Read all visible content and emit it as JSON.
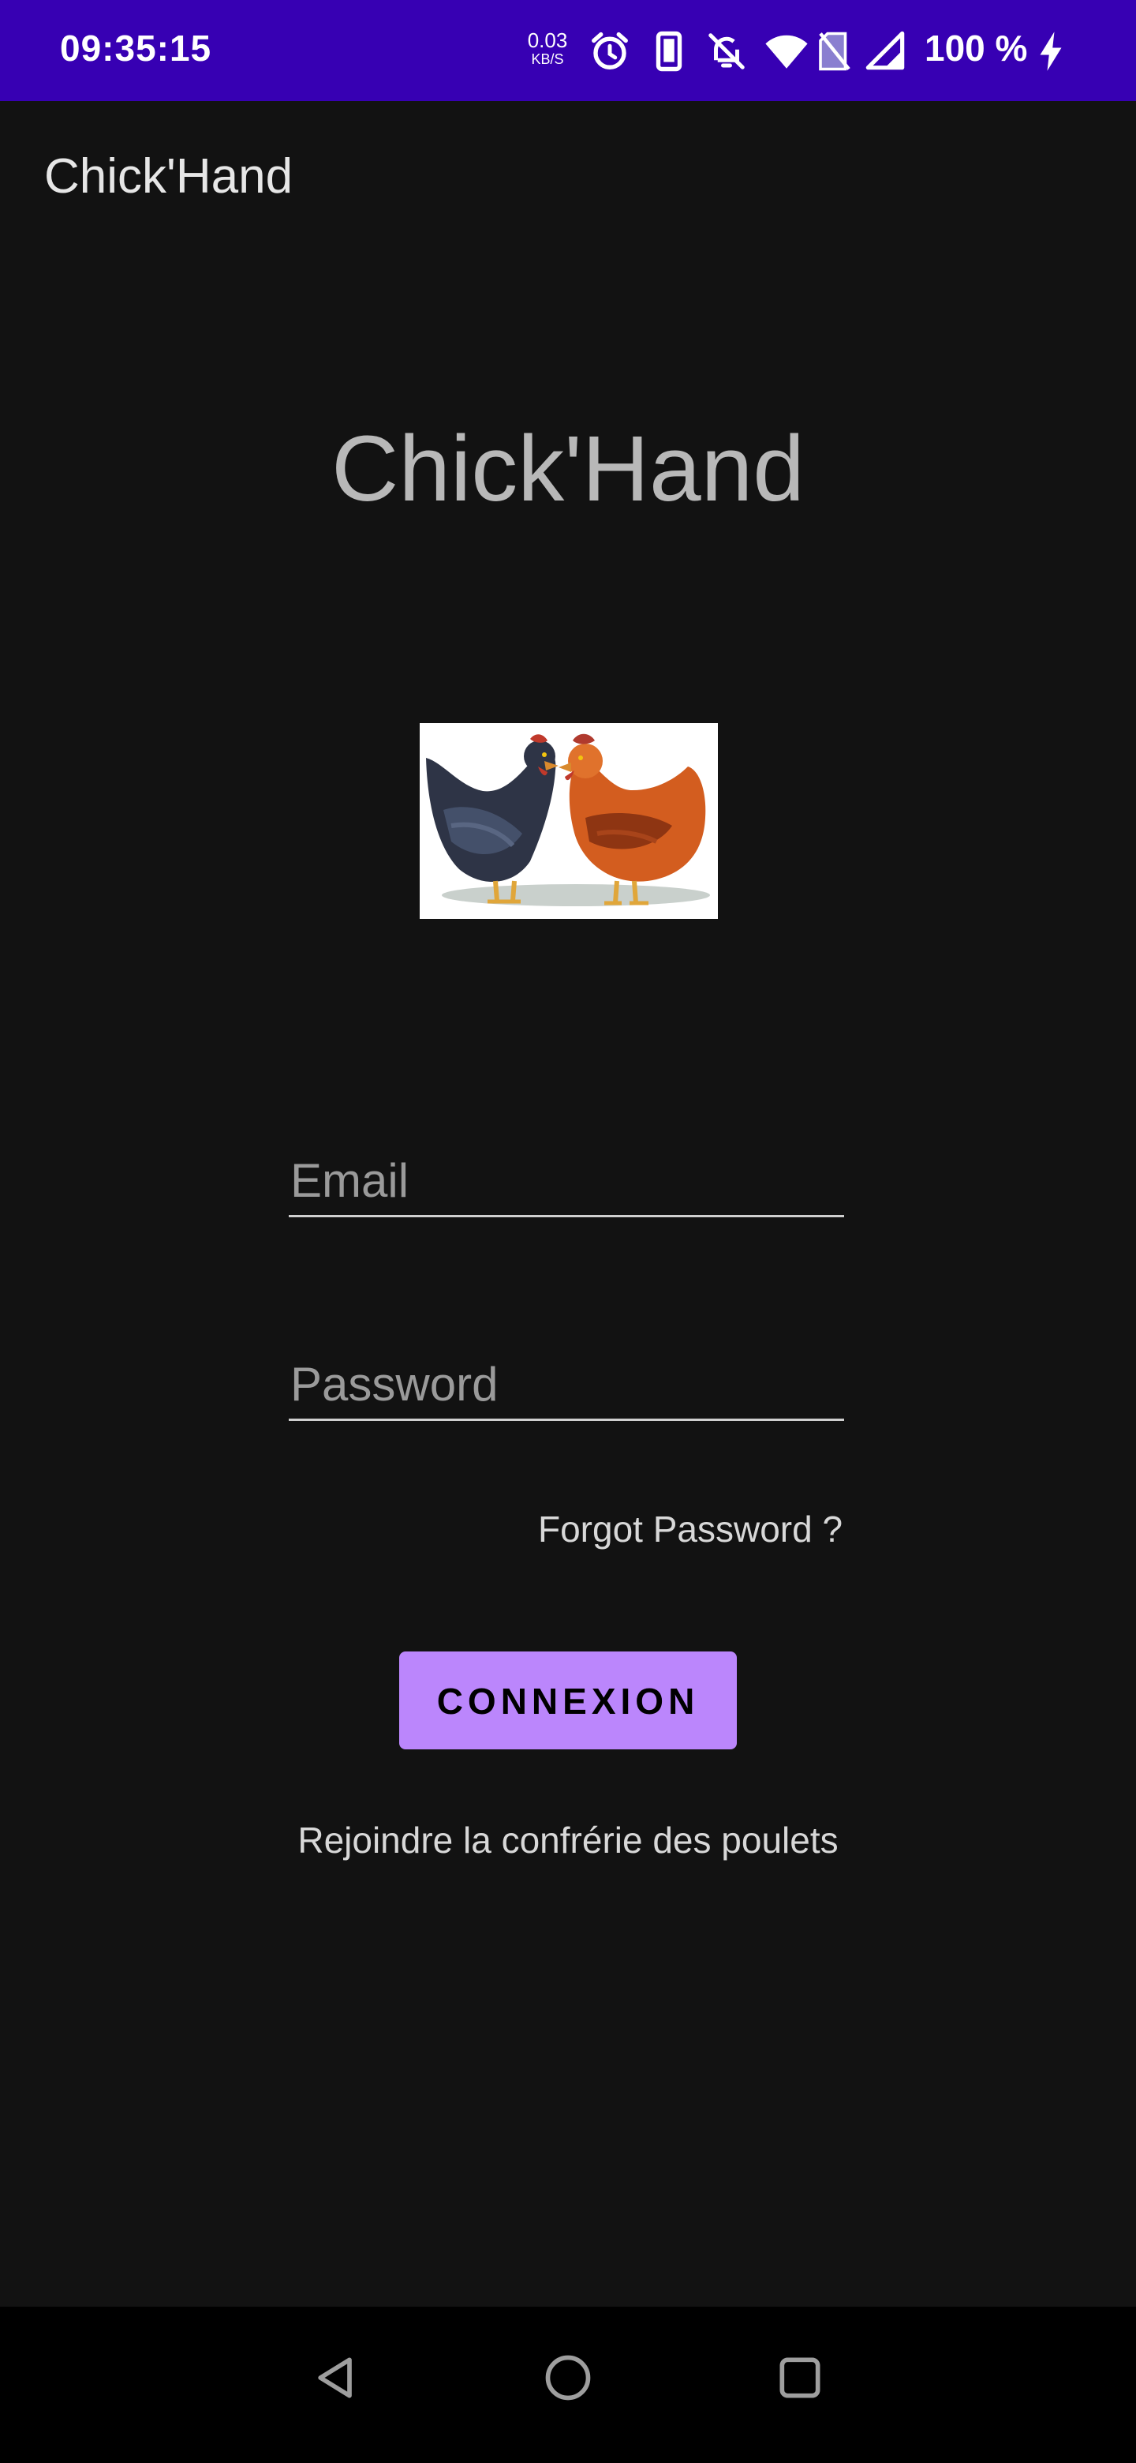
{
  "status_bar": {
    "time": "09:35:15",
    "net_speed_value": "0.03",
    "net_speed_unit": "KB/S",
    "battery": "100 %",
    "icons": [
      "alarm-icon",
      "phone-icon",
      "bell-off-icon",
      "wifi-icon",
      "no-sim-icon",
      "signal-icon",
      "charging-icon"
    ],
    "background": "#3700B3"
  },
  "app_bar": {
    "title": "Chick'Hand"
  },
  "main": {
    "heading": "Chick'Hand",
    "hero_image": "chickens-image",
    "email_placeholder": "Email",
    "password_placeholder": "Password",
    "forgot_password": "Forgot Password ?",
    "login_button": "CONNEXION",
    "join_link": "Rejoindre la confrérie des poulets"
  },
  "nav_bar": {
    "buttons": [
      "back-icon",
      "home-icon",
      "recents-icon"
    ]
  },
  "colors": {
    "background": "#121212",
    "accent": "#BB86FC"
  }
}
